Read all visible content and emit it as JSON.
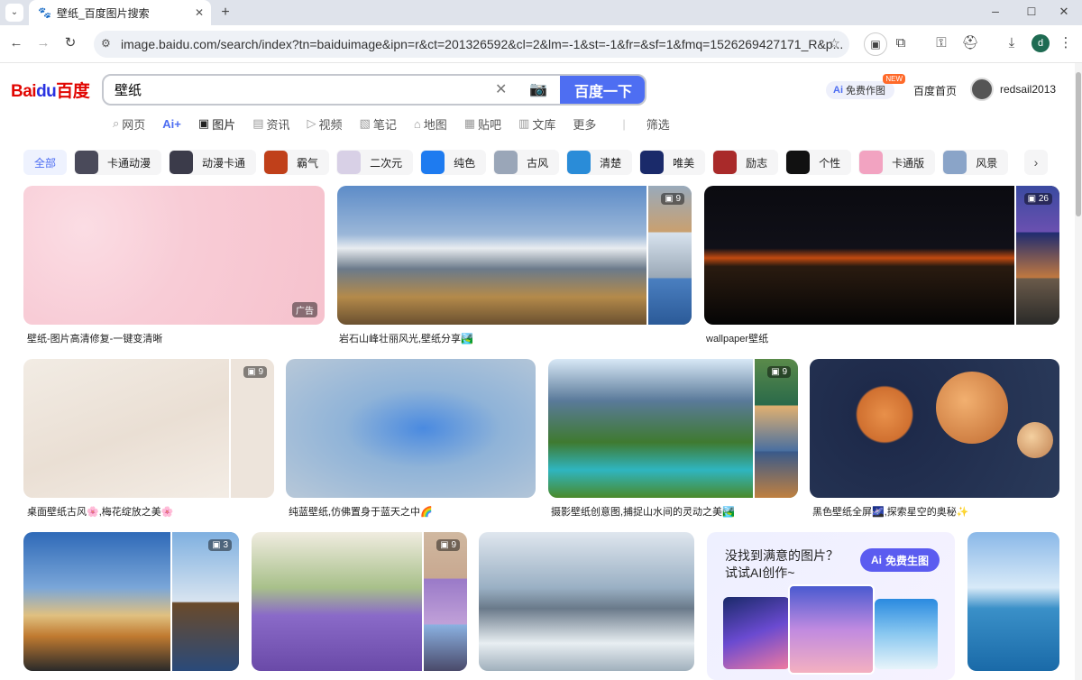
{
  "browser": {
    "tab_title": "壁纸_百度图片搜索",
    "url": "image.baidu.com/search/index?tn=baiduimage&ipn=r&ct=201326592&cl=2&lm=-1&st=-1&fr=&sf=1&fmq=1526269427171_R&p...",
    "profile_initial": "d"
  },
  "header": {
    "logo_text1": "Bai",
    "logo_text2": "du",
    "logo_text3": "百度",
    "search_value": "壁纸",
    "search_button": "百度一下",
    "ai_button": "免费作图",
    "ai_new": "NEW",
    "home_link": "百度首页",
    "username": "redsail2013"
  },
  "nav": [
    "网页",
    "Ai+",
    "图片",
    "资讯",
    "视频",
    "笔记",
    "地图",
    "贴吧",
    "文库",
    "更多",
    "|",
    "筛选"
  ],
  "chips": [
    {
      "label": "全部",
      "color": ""
    },
    {
      "label": "卡通动漫",
      "color": "#4a4a5a"
    },
    {
      "label": "动漫卡通",
      "color": "#3b3b4a"
    },
    {
      "label": "霸气",
      "color": "#c0401a"
    },
    {
      "label": "二次元",
      "color": "#d8d0e6"
    },
    {
      "label": "纯色",
      "color": "#1e7bf0"
    },
    {
      "label": "古风",
      "color": "#9aa6b8"
    },
    {
      "label": "清楚",
      "color": "#2a8cd8"
    },
    {
      "label": "唯美",
      "color": "#1a2a6a"
    },
    {
      "label": "励志",
      "color": "#a92a2a"
    },
    {
      "label": "个性",
      "color": "#111111"
    },
    {
      "label": "卡通版",
      "color": "#f2a3c1"
    },
    {
      "label": "风景",
      "color": "#8aa4c8"
    }
  ],
  "results": [
    {
      "caption": "壁纸-图片高清修复-一键变清晰",
      "badge": "广告"
    },
    {
      "caption": "岩石山峰壮丽风光,壁纸分享🏞️",
      "badge": "9"
    },
    {
      "caption": "wallpaper壁纸",
      "badge": "26"
    },
    {
      "caption": "桌面壁纸古风🌸,梅花绽放之美🌸",
      "badge": "9"
    },
    {
      "caption": "纯蓝壁纸,仿佛置身于蓝天之中🌈",
      "badge": ""
    },
    {
      "caption": "摄影壁纸创意图,捕捉山水间的灵动之美🏞️",
      "badge": "9"
    },
    {
      "caption": "黑色壁纸全屏🌌,探索星空的奥秘✨",
      "badge": ""
    },
    {
      "caption": "",
      "badge": "3"
    },
    {
      "caption": "",
      "badge": "9"
    },
    {
      "caption": "",
      "badge": ""
    }
  ],
  "ai_promo": {
    "line1": "没找到满意的图片？",
    "line2": "试试AI创作~",
    "button": "免费生图"
  }
}
